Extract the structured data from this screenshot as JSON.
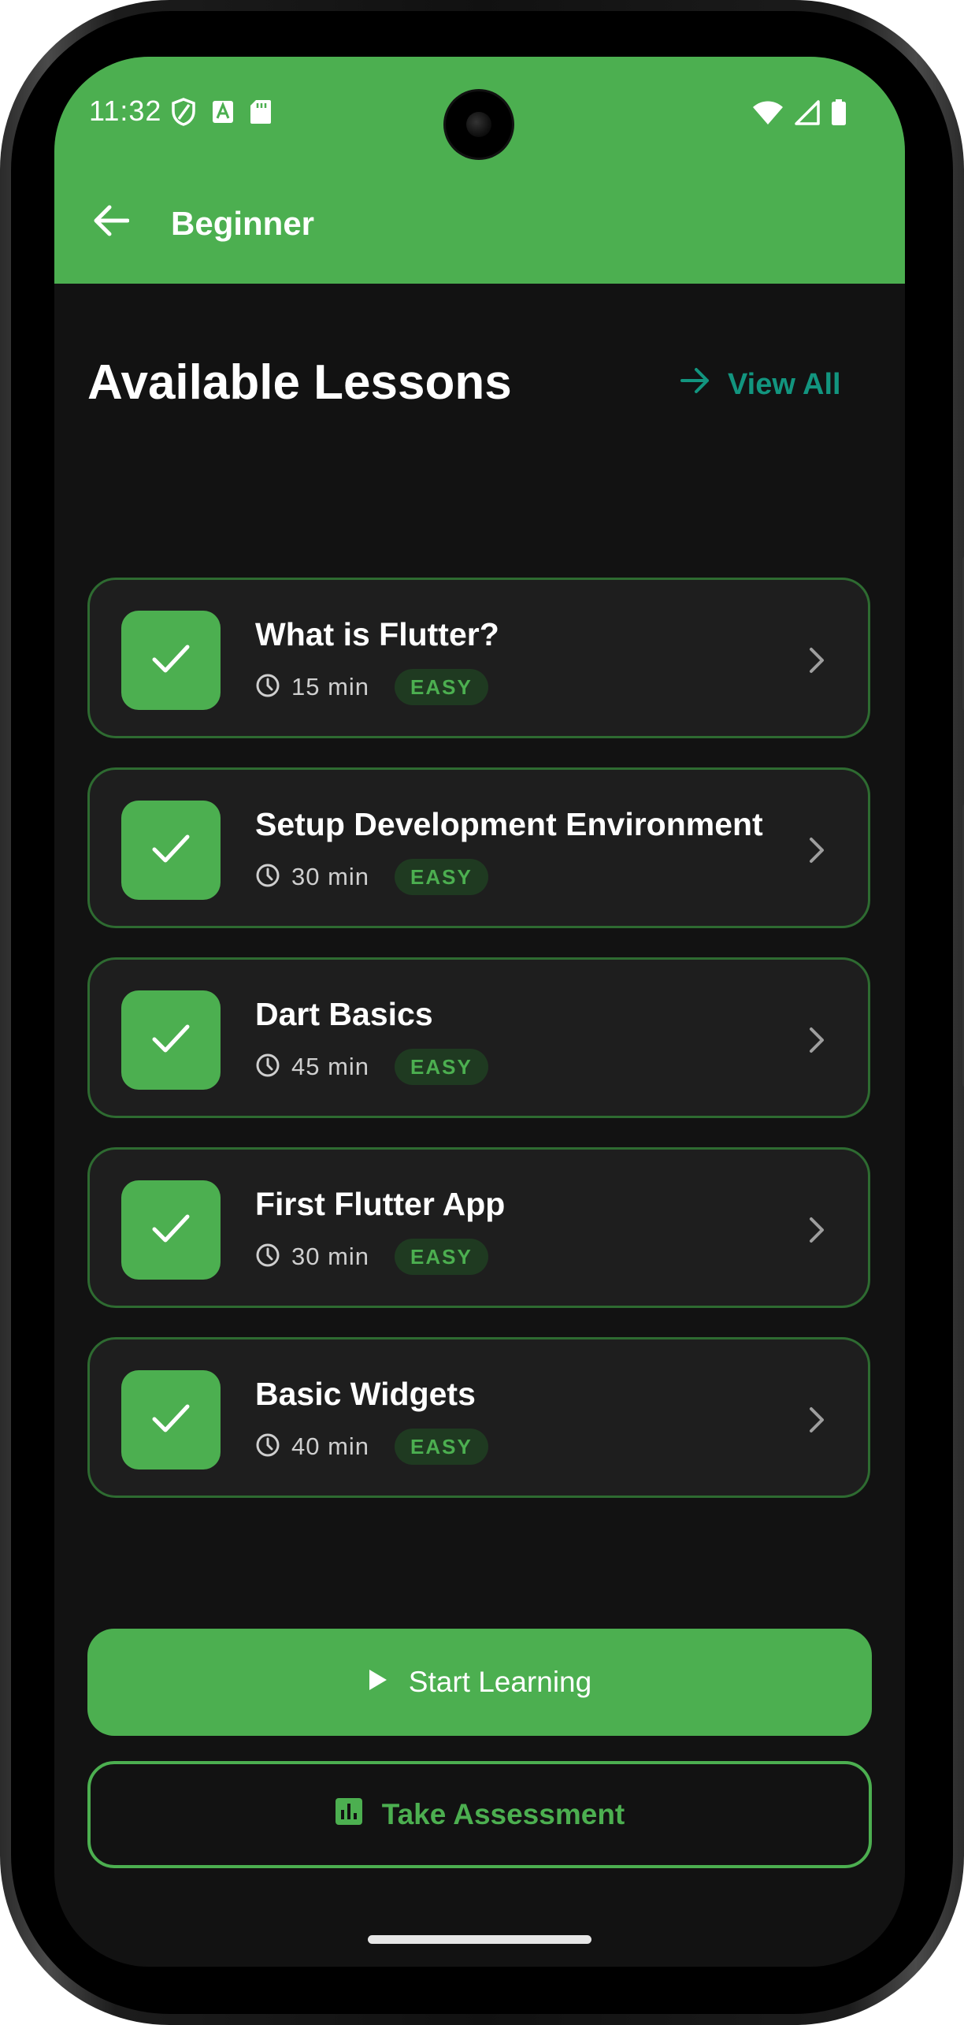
{
  "status_bar": {
    "time": "11:32",
    "left_icons": [
      "shield-icon",
      "text-a-icon",
      "sd-card-icon"
    ],
    "right_icons": [
      "wifi-icon",
      "signal-icon",
      "battery-icon"
    ]
  },
  "app_bar": {
    "back_icon": "arrow-left-icon",
    "title": "Beginner"
  },
  "section": {
    "title": "Available Lessons",
    "view_all_label": "View All",
    "view_all_icon": "arrow-right-icon"
  },
  "lessons": [
    {
      "title": "What is Flutter?",
      "duration": "15 min",
      "difficulty": "EASY"
    },
    {
      "title": "Setup Development Environment",
      "duration": "30 min",
      "difficulty": "EASY"
    },
    {
      "title": "Dart Basics",
      "duration": "45 min",
      "difficulty": "EASY"
    },
    {
      "title": "First Flutter App",
      "duration": "30 min",
      "difficulty": "EASY"
    },
    {
      "title": "Basic Widgets",
      "duration": "40 min",
      "difficulty": "EASY"
    }
  ],
  "actions": {
    "start_label": "Start Learning",
    "start_icon": "play-icon",
    "assess_label": "Take Assessment",
    "assess_icon": "bar-chart-icon"
  },
  "colors": {
    "primary": "#4caf50",
    "background": "#121212",
    "card": "#1e1e1e",
    "card_border": "#2e6b31",
    "link": "#12957f"
  }
}
